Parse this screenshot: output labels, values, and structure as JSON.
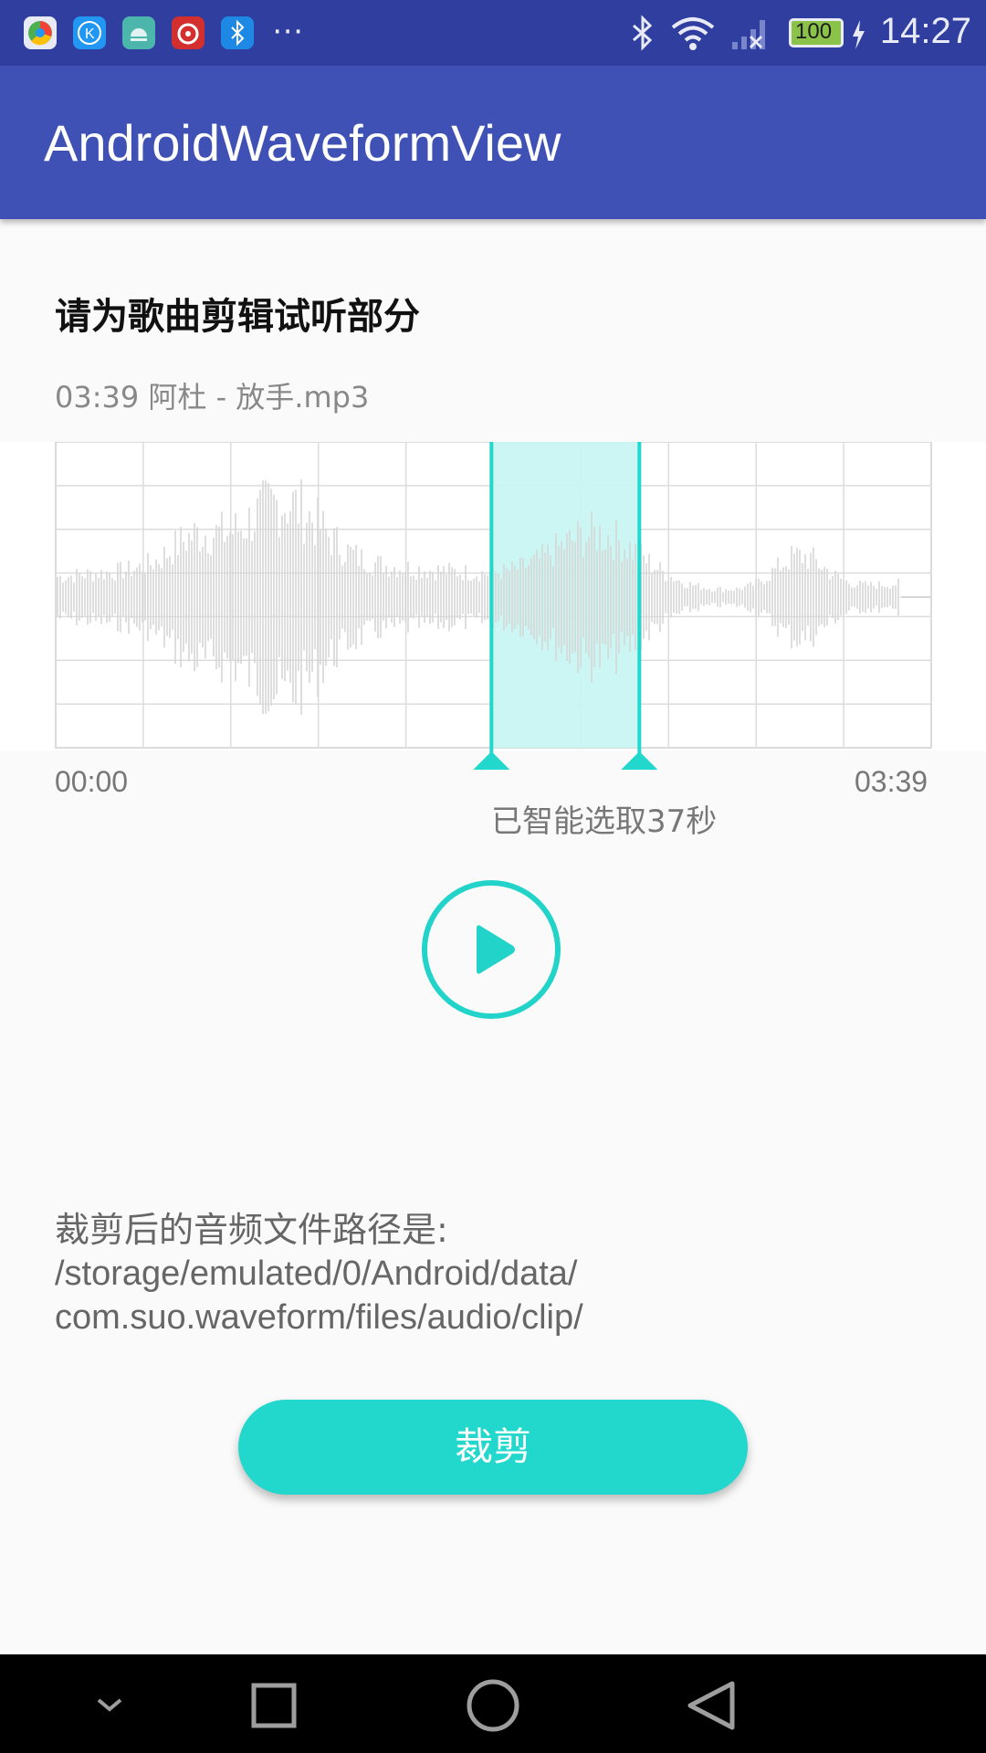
{
  "status_bar": {
    "time": "14:27",
    "battery": "100",
    "icons": [
      "chrome-icon",
      "kugou-icon",
      "android-icon",
      "netease-music-icon",
      "bluetooth-app-icon",
      "more-notifications-icon",
      "bluetooth-icon",
      "wifi-icon",
      "signal-icon",
      "battery-icon",
      "charging-icon"
    ]
  },
  "app_bar": {
    "title": "AndroidWaveformView"
  },
  "main": {
    "heading": "请为歌曲剪辑试听部分",
    "file_info": "03:39 阿杜 - 放手.mp3",
    "waveform": {
      "start_time": "00:00",
      "end_time": "03:39",
      "duration_seconds": 219,
      "selection_start_seconds": 109,
      "selection_end_seconds": 146,
      "selection_text": "已智能选取37秒"
    },
    "path_label": "裁剪后的音频文件路径是:",
    "path_lines": [
      "/storage/emulated/0/Android/data/",
      "com.suo.waveform/files/audio/clip/"
    ],
    "clip_button": "裁剪"
  },
  "colors": {
    "primary": "#3f51b5",
    "primary_dark": "#303f9f",
    "accent": "#22d8cd",
    "selection_fill": "#c8f5f2",
    "waveform": "#d6d6d6"
  },
  "nav_bar": {
    "buttons": [
      "back-chevron-icon",
      "recents-icon",
      "home-icon",
      "back-icon"
    ]
  }
}
